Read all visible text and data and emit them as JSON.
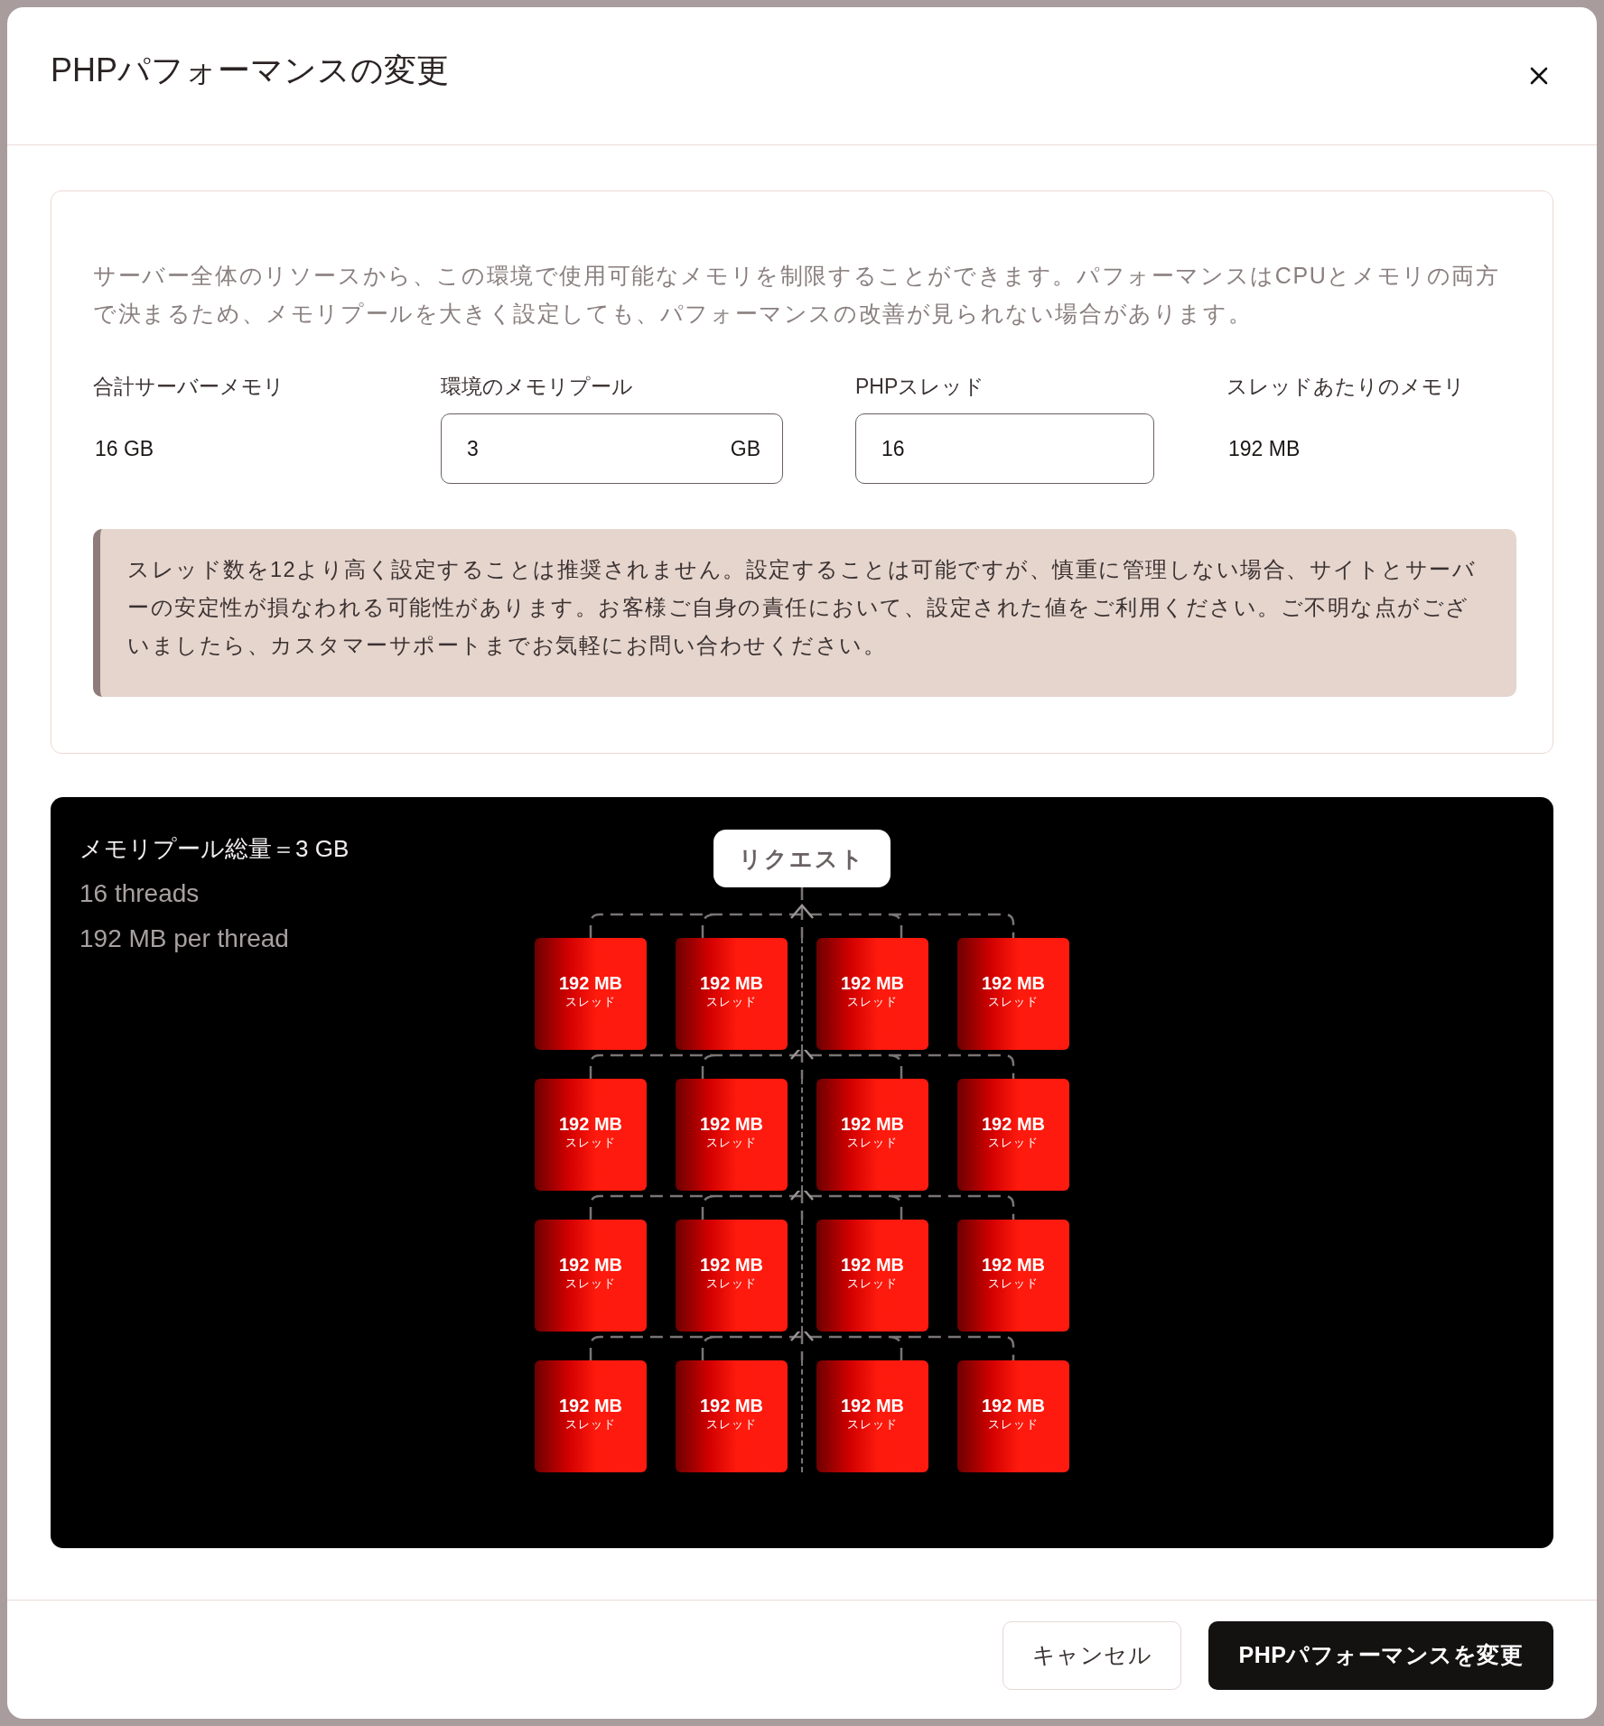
{
  "dialog": {
    "title": "PHPパフォーマンスの変更"
  },
  "description": "サーバー全体のリソースから、この環境で使用可能なメモリを制限することができます。パフォーマンスはCPUとメモリの両方で決まるため、メモリプールを大きく設定しても、パフォーマンスの改善が見られない場合があります。",
  "fields": [
    {
      "kind": "static",
      "label": "合計サーバーメモリ",
      "value": "16 GB"
    },
    {
      "kind": "input",
      "label": "環境のメモリプール",
      "value": "3",
      "unit": "GB"
    },
    {
      "kind": "input",
      "label": "PHPスレッド",
      "value": "16"
    },
    {
      "kind": "static",
      "label": "スレッドあたりのメモリ",
      "value": "192 MB"
    }
  ],
  "warning": "スレッド数を12より高く設定することは推奨されません。設定することは可能ですが、慎重に管理しない場合、サイトとサーバーの安定性が損なわれる可能性があります。お客様ご自身の責任において、設定された値をご利用ください。ご不明な点がございましたら、カスタマーサポートまでお気軽にお問い合わせください。",
  "diagram": {
    "summary": "メモリプール総量＝3 GB",
    "details": [
      "16 threads",
      "192 MB per thread"
    ],
    "request": "リクエスト",
    "threads": [
      {
        "memory": "192 MB",
        "label": "スレッド"
      },
      {
        "memory": "192 MB",
        "label": "スレッド"
      },
      {
        "memory": "192 MB",
        "label": "スレッド"
      },
      {
        "memory": "192 MB",
        "label": "スレッド"
      },
      {
        "memory": "192 MB",
        "label": "スレッド"
      },
      {
        "memory": "192 MB",
        "label": "スレッド"
      },
      {
        "memory": "192 MB",
        "label": "スレッド"
      },
      {
        "memory": "192 MB",
        "label": "スレッド"
      },
      {
        "memory": "192 MB",
        "label": "スレッド"
      },
      {
        "memory": "192 MB",
        "label": "スレッド"
      },
      {
        "memory": "192 MB",
        "label": "スレッド"
      },
      {
        "memory": "192 MB",
        "label": "スレッド"
      },
      {
        "memory": "192 MB",
        "label": "スレッド"
      },
      {
        "memory": "192 MB",
        "label": "スレッド"
      },
      {
        "memory": "192 MB",
        "label": "スレッド"
      },
      {
        "memory": "192 MB",
        "label": "スレッド"
      }
    ]
  },
  "buttons": [
    {
      "kind": "secondary",
      "label": "キャンセル"
    },
    {
      "kind": "primary",
      "label": "PHPパフォーマンスを変更"
    }
  ]
}
